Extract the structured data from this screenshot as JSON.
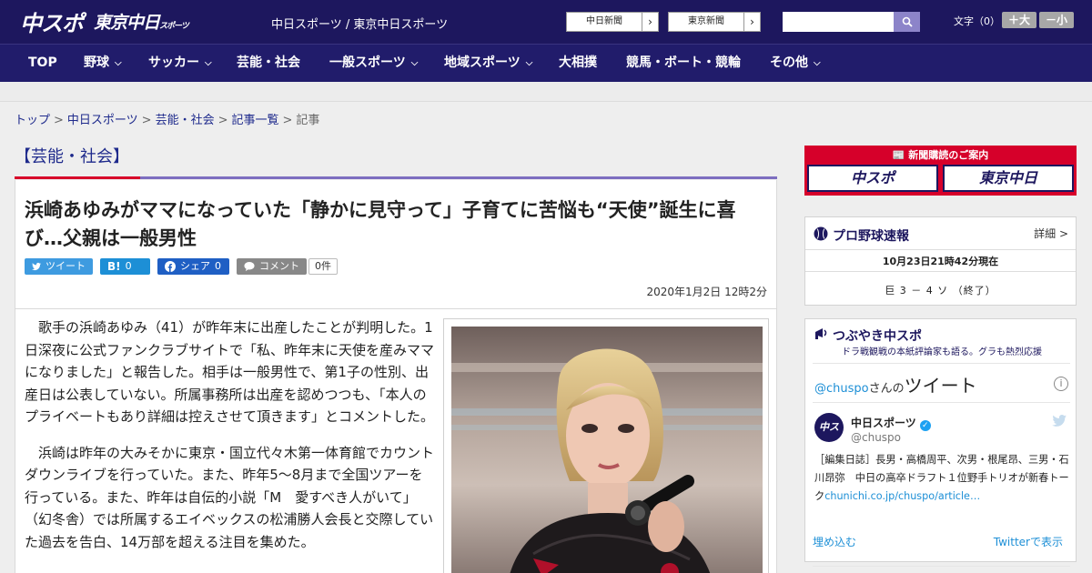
{
  "header": {
    "logo_main": "中スポ",
    "logo_sub": "東京中日",
    "logo_sub_small": "スポーツ",
    "site_links": "中日スポーツ / 東京中日スポーツ",
    "ext_buttons": [
      "中日新聞",
      "東京新聞"
    ],
    "search_placeholder": "",
    "font_label": "文字（0）",
    "font_larger": "＋大",
    "font_smaller": "－小"
  },
  "nav": {
    "items": [
      "TOP",
      "野球",
      "サッカー",
      "芸能・社会",
      "一般スポーツ",
      "地域スポーツ",
      "大相撲",
      "競馬・ボート・競輪",
      "その他"
    ]
  },
  "breadcrumb": {
    "items": [
      "トップ",
      "中日スポーツ",
      "芸能・社会",
      "記事一覧"
    ],
    "current": "記事"
  },
  "article": {
    "category": "【芸能・社会】",
    "headline": "浜崎あゆみがママになっていた「静かに見守って」子育てに苦悩も“天使”誕生に喜び…父親は一般男性",
    "share": {
      "tweet": "ツイート",
      "hatena": "B!",
      "hatena_count": "0",
      "facebook": "シェア",
      "facebook_count": "0",
      "comment": "コメント",
      "comment_count": "0件"
    },
    "date": "2020年1月2日 12時2分",
    "paragraphs": [
      "歌手の浜崎あゆみ（41）が昨年末に出産したことが判明した。1日深夜に公式ファンクラブサイトで「私、昨年末に天使を産みママになりました」と報告した。相手は一般男性で、第1子の性別、出産日は公表していない。所属事務所は出産を認めつつも、「本人のプライベートもあり詳細は控えさせて頂きます」とコメントした。",
      "浜崎は昨年の大みそかに東京・国立代々木第一体育館でカウントダウンライブを行っていた。また、昨年5～8月まで全国ツアーを行っている。また、昨年は自伝的小説「M　愛すべき人がいて」（幻冬舎）では所属するエイベックスの松浦勝人会長と交際していた過去を告白、14万部を超える注目を集めた。"
    ]
  },
  "sidebar": {
    "ad_title": "新聞購読のご案内",
    "ad_logos": [
      "中スポ",
      "東京中日"
    ],
    "baseball": {
      "title": "プロ野球速報",
      "more": "詳細 >",
      "time": "10月23日21時42分現在",
      "score": "巨 3 － 4 ソ （終了）"
    },
    "tweets": {
      "title": "つぶやき中スポ",
      "subtitle": "ドラ戦観戦の本紙評論家も語る。グラも熱烈応援",
      "user": "@chuspo",
      "san": "さんの",
      "tweet_word": "ツイート",
      "avatar": "中スポ",
      "account_name": "中日スポーツ",
      "account_handle": "@chuspo",
      "tweet_text": "［編集日誌］長男・高橋周平、次男・根尾昂、三男・石川昂弥　中日の高卒ドラフト１位野手トリオが新春トーク",
      "tweet_link": "chunichi.co.jp/chuspo/article…",
      "embed": "埋め込む",
      "view_on_twitter": "Twitterで表示"
    }
  },
  "colors": {
    "header_bg": "#1d175e",
    "nav_bg": "#211c6b",
    "accent_red": "#d7002a",
    "link_blue": "#1e2a8c"
  }
}
